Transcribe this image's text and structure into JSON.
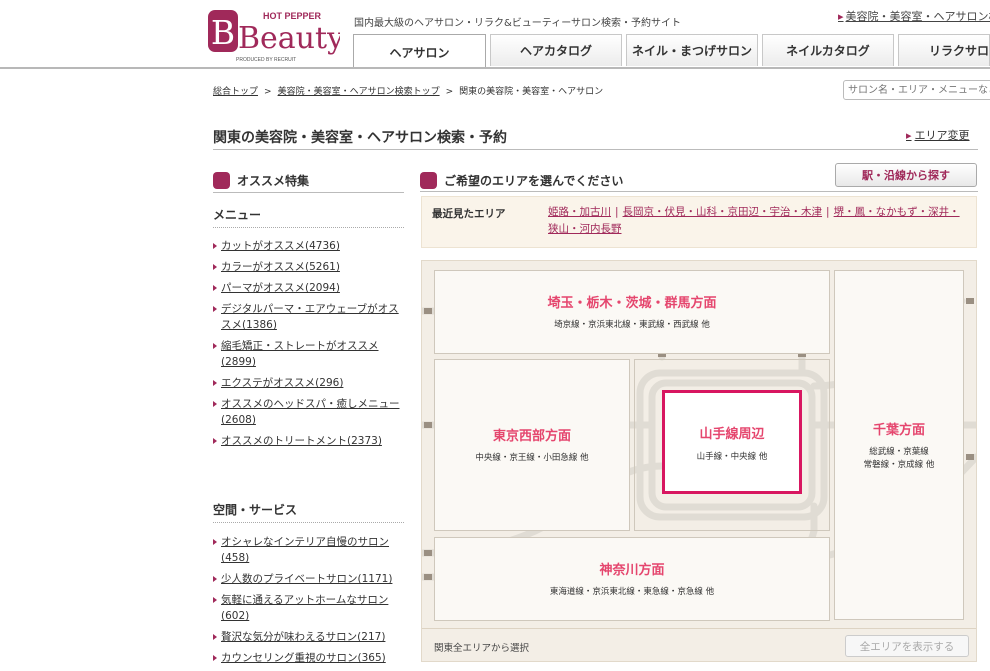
{
  "header": {
    "logo_top": "HOT PEPPER",
    "logo_main": "Beauty",
    "logo_sub": "PRODUCED BY RECRUIT",
    "tagline": "国内最大級のヘアサロン・リラク&ビューティーサロン検索・予約サイト",
    "top_link": "美容院・美容室・ヘアサロン検",
    "tabs": [
      {
        "label": "ヘアサロン",
        "active": true
      },
      {
        "label": "ヘアカタログ",
        "active": false
      },
      {
        "label": "ネイル・まつげサロン",
        "active": false
      },
      {
        "label": "ネイルカタログ",
        "active": false
      },
      {
        "label": "リラクサロン",
        "active": false
      }
    ]
  },
  "breadcrumb": [
    "総合トップ",
    "美容院・美容室・ヘアサロン検索トップ",
    "関東の美容院・美容室・ヘアサロン"
  ],
  "search": {
    "placeholder": "サロン名・エリア・メニューなど"
  },
  "page_title": "関東の美容院・美容室・ヘアサロン検索・予約",
  "change_area": "エリア変更",
  "sidebar": {
    "heading": "オススメ特集",
    "menu_heading": "メニュー",
    "menu_items": [
      "カットがオススメ(4736)",
      "カラーがオススメ(5261)",
      "パーマがオススメ(2094)",
      "デジタルパーマ・エアウェーブがオススメ(1386)",
      "縮毛矯正・ストレートがオススメ(2899)",
      "エクステがオススメ(296)",
      "オススメのヘッドスパ・癒しメニュー(2608)",
      "オススメのトリートメント(2373)"
    ],
    "space_heading": "空間・サービス",
    "space_items": [
      "オシャレなインテリア自慢のサロン(458)",
      "少人数のプライベートサロン(1171)",
      "気軽に通えるアットホームなサロン(602)",
      "贅沢な気分が味わえるサロン(217)",
      "カウンセリング重視のサロン(365)"
    ]
  },
  "area": {
    "heading": "ご希望のエリアを選んでください",
    "station_button": "駅・沿線から探す",
    "recent_label": "最近見たエリア",
    "recent_links": [
      "姫路・加古川",
      "長岡京・伏見・山科・京田辺・宇治・木津",
      "堺・鳳・なかもず・深井・狭山・河内長野"
    ],
    "regions": {
      "north": {
        "name": "埼玉・栃木・茨城・群馬方面",
        "lines": "埼京線・京浜東北線・東武線・西武線 他"
      },
      "west": {
        "name": "東京西部方面",
        "lines": "中央線・京王線・小田急線 他"
      },
      "center": {
        "name": "山手線周辺",
        "lines": "山手線・中央線 他"
      },
      "east": {
        "name": "千葉方面",
        "lines1": "総武線・京葉線",
        "lines2": "常磐線・京成線 他"
      },
      "south": {
        "name": "神奈川方面",
        "lines": "東海道線・京浜東北線・東急線・京急線 他"
      }
    },
    "all_kanto": "関東全エリアから選択",
    "show_all_button": "全エリアを表示する"
  },
  "colors": {
    "brand": "#a0295a",
    "region_name": "#e5466e",
    "highlight_border": "#d81660"
  }
}
